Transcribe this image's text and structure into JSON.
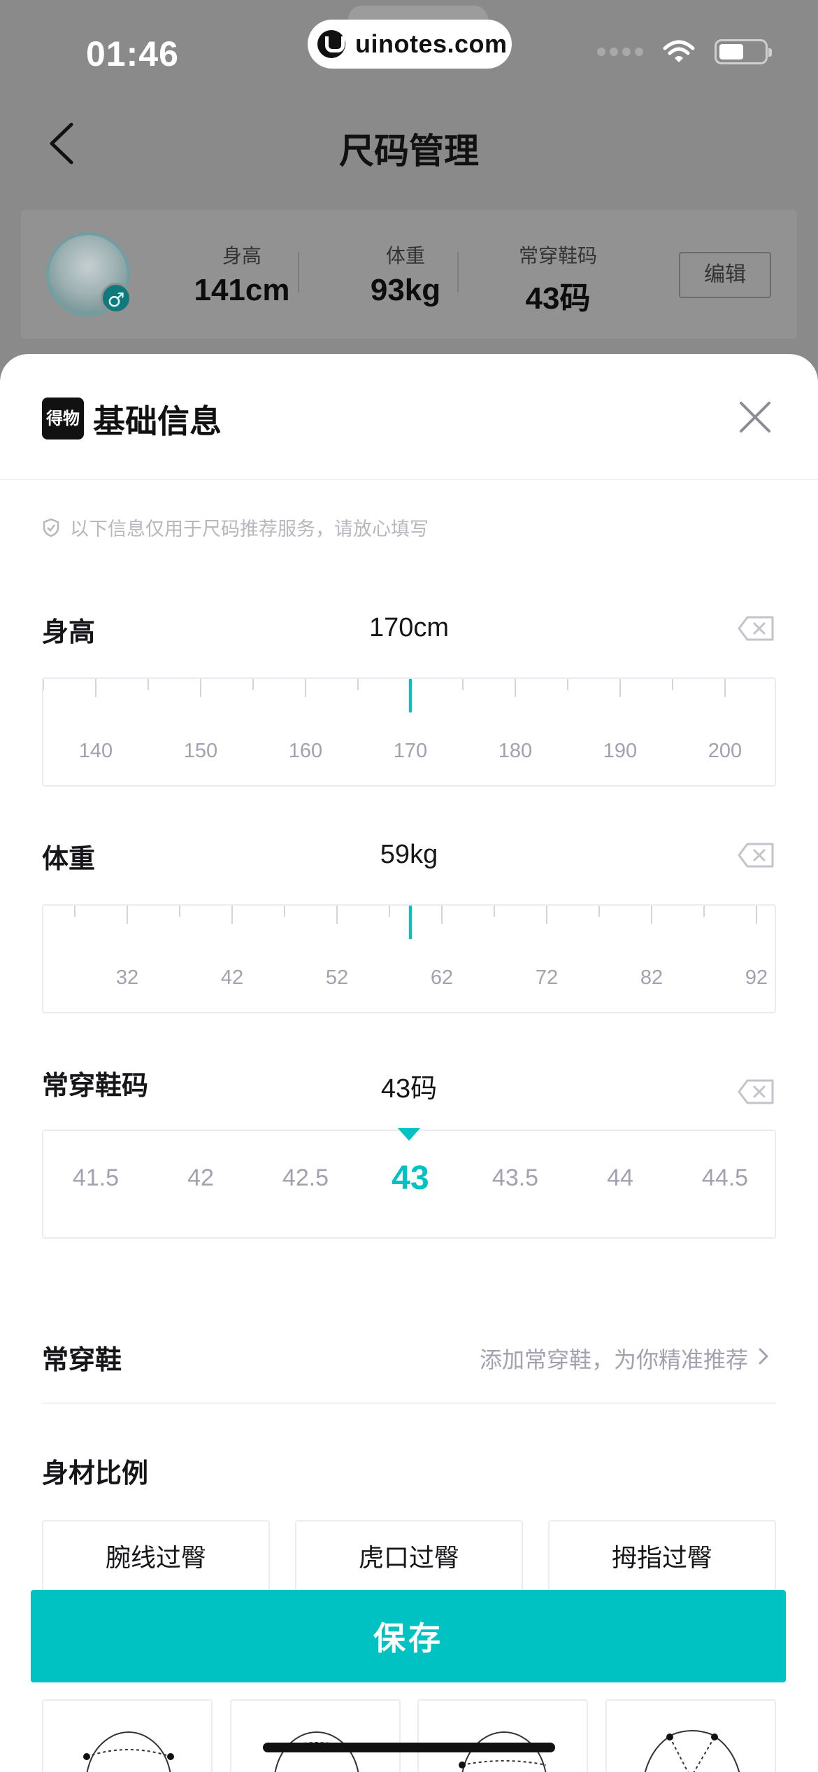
{
  "status_bar": {
    "time": "01:46",
    "watermark": "uinotes.com"
  },
  "nav": {
    "title": "尺码管理"
  },
  "profile": {
    "stats": [
      {
        "label": "身高",
        "value": "141cm"
      },
      {
        "label": "体重",
        "value": "93kg"
      },
      {
        "label": "常穿鞋码",
        "value": "43码"
      }
    ],
    "gender_symbol": "♂",
    "edit_label": "编辑"
  },
  "sheet": {
    "brand_text": "得物",
    "title": "基础信息",
    "privacy_note": "以下信息仅用于尺码推荐服务，请放心填写"
  },
  "height": {
    "label": "身高",
    "value_text": "170cm",
    "value": 170,
    "ticks": [
      "140",
      "150",
      "160",
      "170",
      "180",
      "190",
      "200"
    ]
  },
  "weight": {
    "label": "体重",
    "value_text": "59kg",
    "value": 59,
    "ticks": [
      "32",
      "42",
      "52",
      "62",
      "72",
      "82",
      "92"
    ]
  },
  "shoe": {
    "label": "常穿鞋码",
    "value_text": "43码",
    "options": [
      "41.5",
      "42",
      "42.5",
      "43",
      "43.5",
      "44",
      "44.5"
    ],
    "selected_index": 3
  },
  "favorite_shoes": {
    "label": "常穿鞋",
    "hint": "添加常穿鞋，为你精准推荐"
  },
  "body_ratio": {
    "label": "身材比例",
    "options": [
      "腕线过臀",
      "虎口过臀",
      "拇指过臀"
    ]
  },
  "save_label": "保存",
  "colors": {
    "accent": "#01c2c3",
    "text": "#16161a",
    "muted": "#a1a1b0"
  }
}
